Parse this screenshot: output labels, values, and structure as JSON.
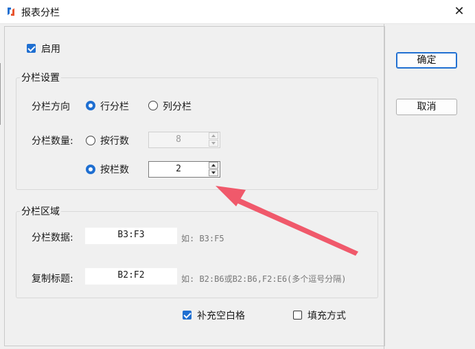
{
  "window": {
    "title": "报表分栏",
    "close_glyph": "✕",
    "icon": "app-logo-icon",
    "accent_color": "#1f6fd1",
    "arrow_color": "#f0596b"
  },
  "enable": {
    "label": "启用",
    "checked": true
  },
  "settings": {
    "group_label": "分栏设置",
    "direction_label": "分栏方向",
    "direction_options": [
      {
        "label": "行分栏",
        "selected": true
      },
      {
        "label": "列分栏",
        "selected": false
      }
    ],
    "count_label": "分栏数量:",
    "by_rows": {
      "label": "按行数",
      "selected": false,
      "value": "8",
      "enabled": false
    },
    "by_columns": {
      "label": "按栏数",
      "selected": true,
      "value": "2",
      "enabled": true
    }
  },
  "region": {
    "group_label": "分栏区域",
    "data_label": "分栏数据:",
    "data_value": "B3:F3",
    "data_hint": "如: B3:F5",
    "title_label": "复制标题:",
    "title_value": "B2:F2",
    "title_hint": "如: B2:B6或B2:B6,F2:E6(多个逗号分隔)"
  },
  "options": {
    "fill_blank": {
      "label": "补充空白格",
      "checked": true
    },
    "fill_mode": {
      "label": "填充方式",
      "checked": false
    }
  },
  "buttons": {
    "ok": "确定",
    "cancel": "取消"
  }
}
